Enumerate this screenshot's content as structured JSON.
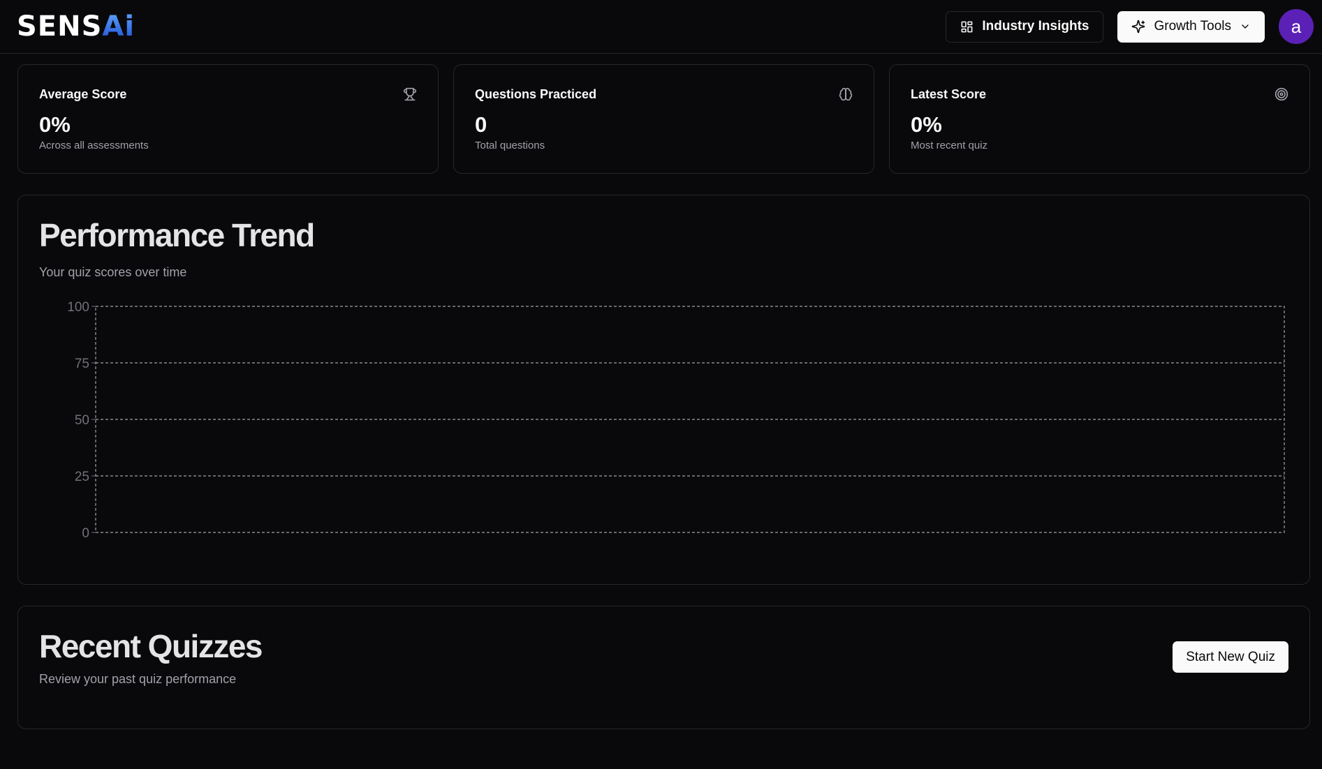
{
  "header": {
    "logo_main": "SENS",
    "logo_accent": "Ai",
    "industry_insights_label": "Industry Insights",
    "growth_tools_label": "Growth Tools",
    "avatar_letter": "a"
  },
  "stats": [
    {
      "title": "Average Score",
      "value": "0%",
      "subtitle": "Across all assessments",
      "icon": "trophy-icon"
    },
    {
      "title": "Questions Practiced",
      "value": "0",
      "subtitle": "Total questions",
      "icon": "brain-icon"
    },
    {
      "title": "Latest Score",
      "value": "0%",
      "subtitle": "Most recent quiz",
      "icon": "target-icon"
    }
  ],
  "performance": {
    "title": "Performance Trend",
    "subtitle": "Your quiz scores over time"
  },
  "recent": {
    "title": "Recent Quizzes",
    "subtitle": "Review your past quiz performance",
    "start_button": "Start New Quiz"
  },
  "chart_data": {
    "type": "line",
    "title": "Performance Trend",
    "subtitle": "Your quiz scores over time",
    "x": [],
    "series": [],
    "ylim": [
      0,
      100
    ],
    "yticks": [
      "0",
      "25",
      "50",
      "75",
      "100"
    ],
    "grid": true,
    "xlabel": "",
    "ylabel": ""
  },
  "colors": {
    "background": "#09090b",
    "border": "#27272a",
    "avatar": "#5b21b6",
    "grid": "#a1a1aa"
  }
}
